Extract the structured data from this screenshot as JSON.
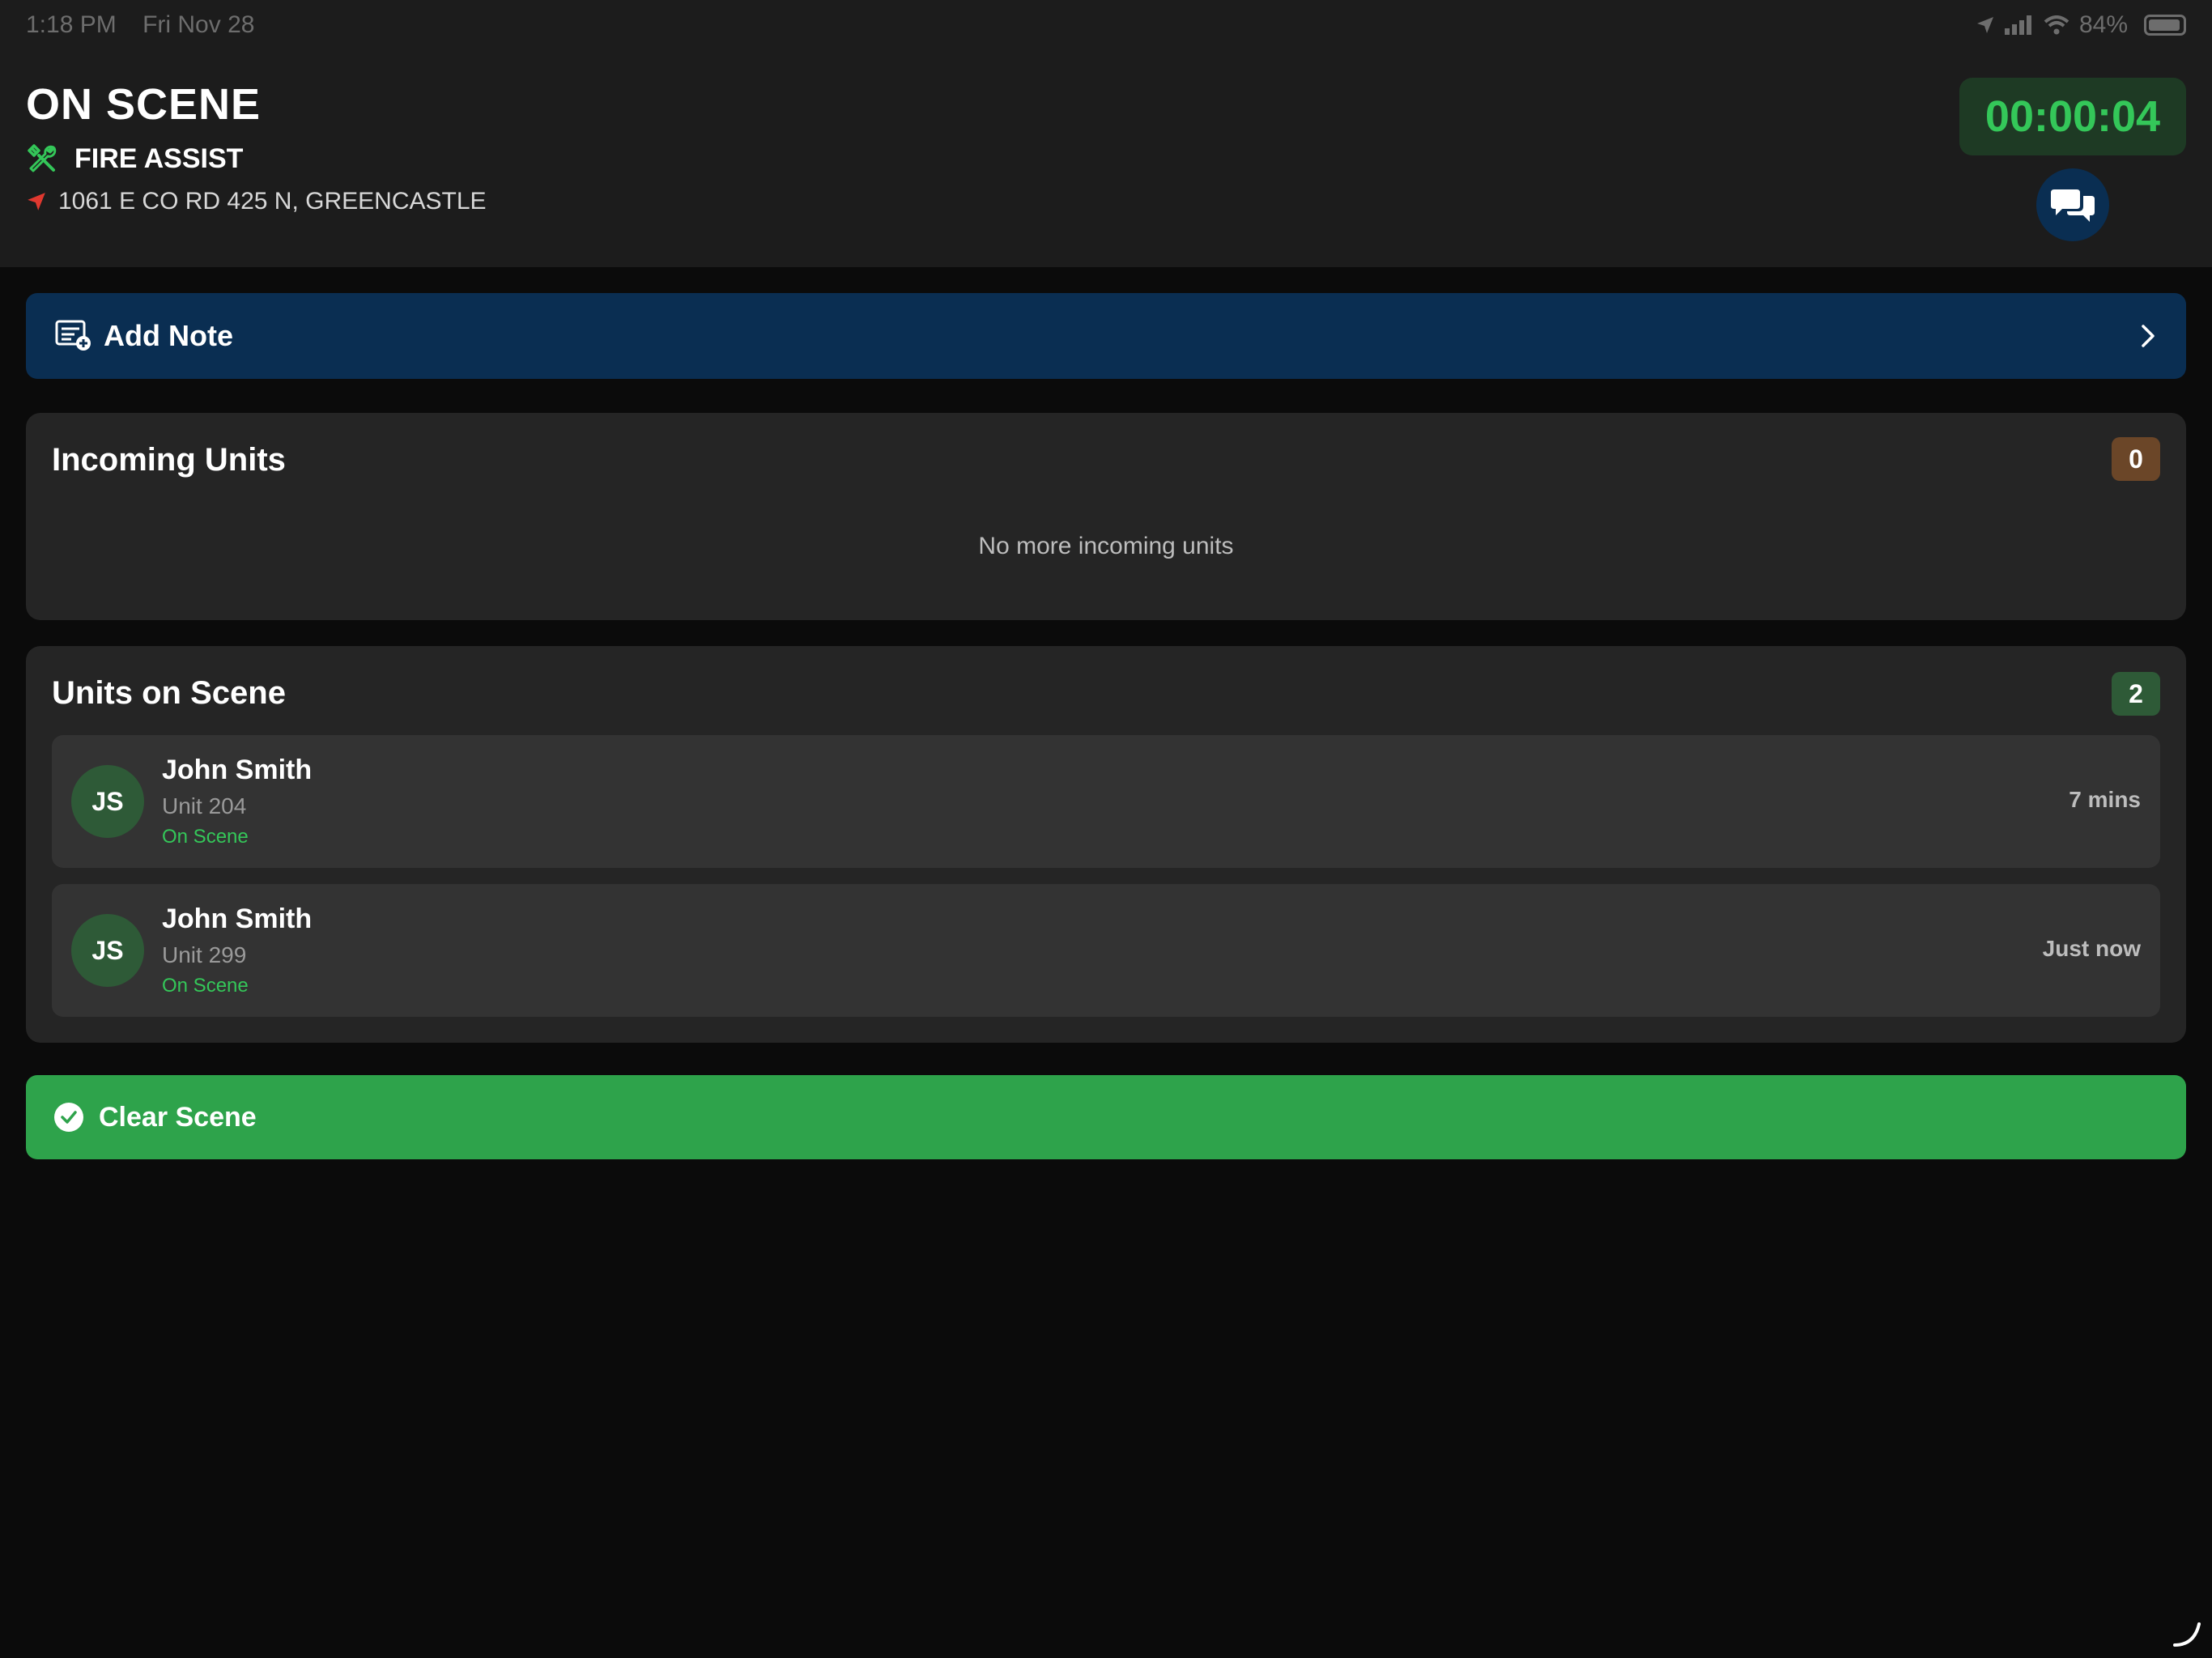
{
  "status_bar": {
    "time": "1:18 PM",
    "date": "Fri Nov 28",
    "battery": "84%"
  },
  "header": {
    "title": "ON SCENE",
    "incident_type": "FIRE ASSIST",
    "address": "1061 E CO RD 425 N, GREENCASTLE",
    "timer": "00:00:04"
  },
  "add_note": {
    "label": "Add Note"
  },
  "incoming_units": {
    "title": "Incoming Units",
    "count": "0",
    "empty_message": "No more incoming units"
  },
  "units_on_scene": {
    "title": "Units on Scene",
    "count": "2",
    "units": [
      {
        "initials": "JS",
        "name": "John Smith",
        "unit": "Unit 204",
        "status": "On Scene",
        "time": "7 mins"
      },
      {
        "initials": "JS",
        "name": "John Smith",
        "unit": "Unit 299",
        "status": "On Scene",
        "time": "Just now"
      }
    ]
  },
  "clear_scene": {
    "label": "Clear Scene"
  },
  "colors": {
    "accent_green": "#34c759",
    "note_blue": "#0a2e52",
    "clear_green": "#2ea34b",
    "incoming_badge": "#6b4628",
    "scene_badge": "#2e5a37",
    "location_red": "#e0382f"
  },
  "icons": {
    "incident": "tools-icon",
    "address": "location-arrow-icon",
    "chat": "chat-bubbles-icon",
    "note": "add-note-icon",
    "chevron": "chevron-right-icon",
    "clear": "checkmark-circle-icon"
  }
}
